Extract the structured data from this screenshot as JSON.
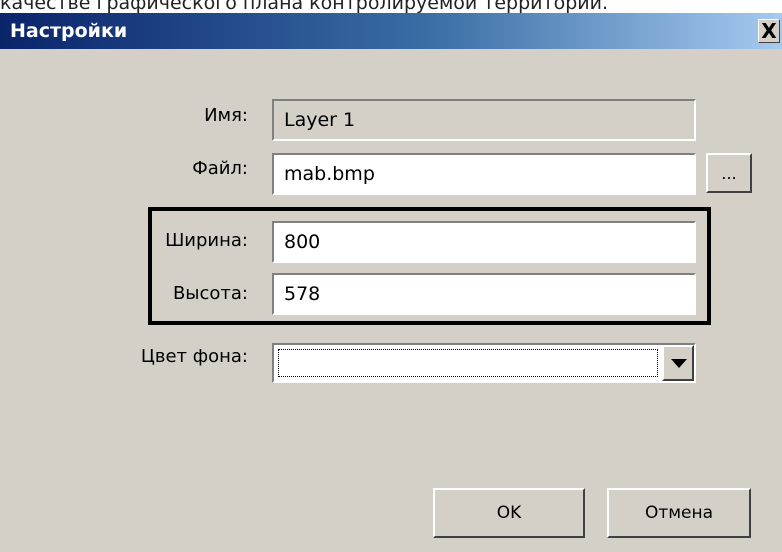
{
  "page_caption": "качестве графического плана контролируемой территории.",
  "dialog": {
    "title": "Настройки",
    "close_label": "X"
  },
  "form": {
    "name_label": "Имя:",
    "name_value": "Layer 1",
    "file_label": "Файл:",
    "file_value": "mab.bmp",
    "browse_label": "...",
    "width_label": "Ширина:",
    "width_value": "800",
    "height_label": "Высота:",
    "height_value": "578",
    "bg_color_label": "Цвет фона:",
    "bg_color_value": ""
  },
  "buttons": {
    "ok_label": "OK",
    "cancel_label": "Отмена"
  },
  "icons": {
    "combo_arrow": "chevron-down-icon",
    "close": "close-icon"
  },
  "colors": {
    "window_bg": "#d4d0c8",
    "title_gradient_start": "#0a246a",
    "title_gradient_end": "#a6caf0",
    "highlight_frame": "#000000"
  }
}
